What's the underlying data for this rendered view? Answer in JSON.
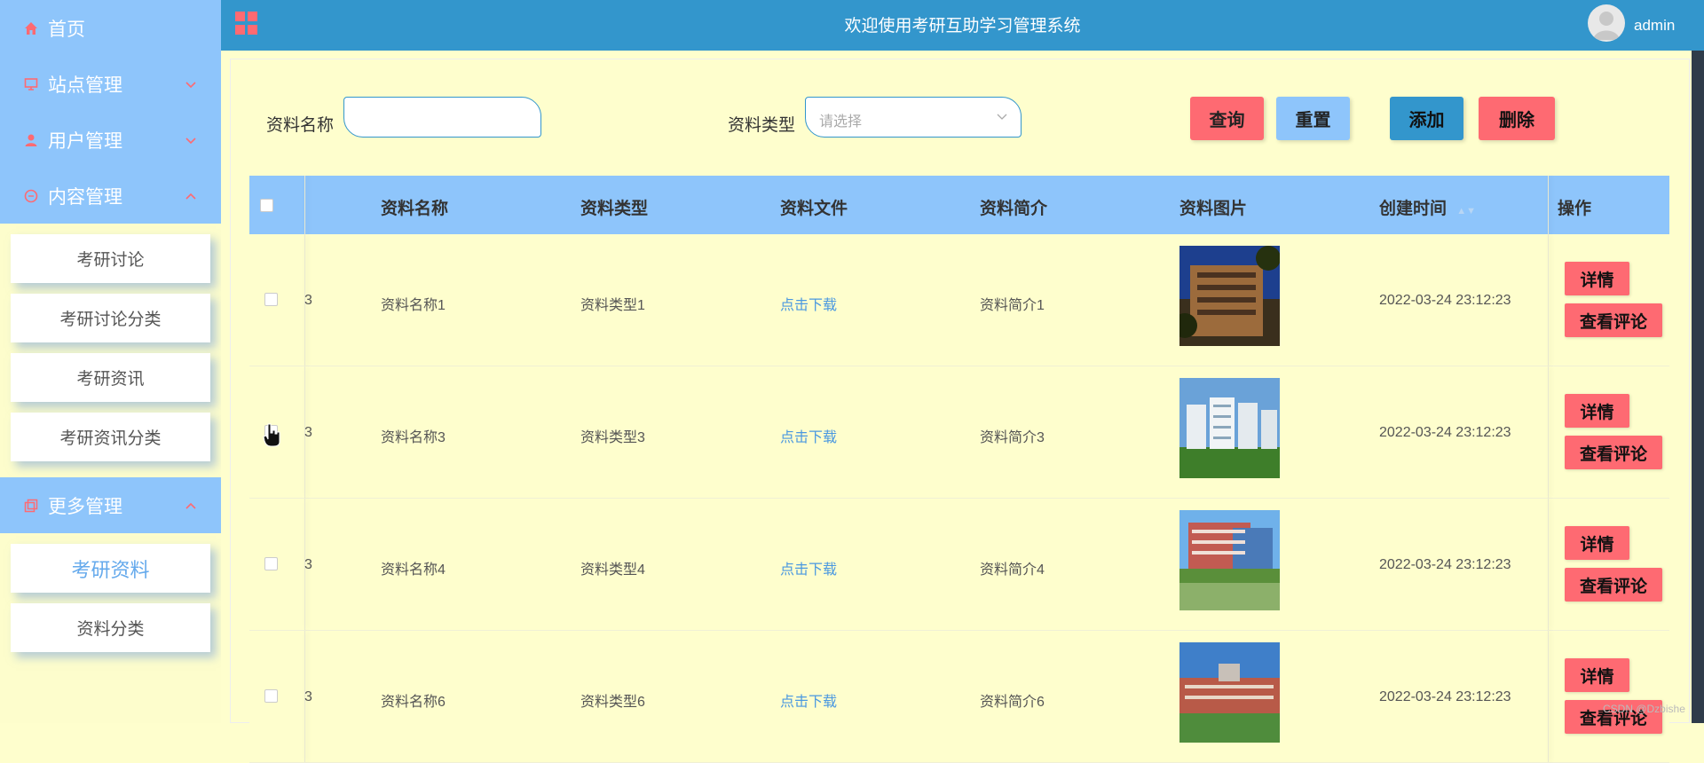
{
  "app": {
    "title": "欢迎使用考研互助学习管理系统",
    "username": "admin"
  },
  "colors": {
    "primary": "#3396cc",
    "sidebar": "#8ec5fb",
    "accent": "#fe6a72",
    "page_bg": "#fefecd"
  },
  "sidebar": {
    "home": "首页",
    "site": "站点管理",
    "users": "用户管理",
    "content": "内容管理",
    "content_items": [
      "考研讨论",
      "考研讨论分类",
      "考研资讯",
      "考研资讯分类"
    ],
    "more": "更多管理",
    "more_items": [
      "考研资料",
      "资料分类"
    ],
    "active_item": "考研资料"
  },
  "search": {
    "name_label": "资料名称",
    "name_value": "",
    "type_label": "资料类型",
    "type_placeholder": "请选择",
    "query": "查询",
    "reset": "重置",
    "add": "添加",
    "delete": "删除"
  },
  "table": {
    "headers": {
      "name": "资料名称",
      "type": "资料类型",
      "file": "资料文件",
      "intro": "资料简介",
      "image": "资料图片",
      "created": "创建时间",
      "ops": "操作"
    },
    "rows": [
      {
        "idx": "3",
        "name": "资料名称1",
        "type": "资料类型1",
        "file": "点击下载",
        "intro": "资料简介1",
        "created": "2022-03-24 23:12:23",
        "image": "campus-building-night"
      },
      {
        "idx": "3",
        "name": "资料名称3",
        "type": "资料类型3",
        "file": "点击下载",
        "intro": "资料简介3",
        "created": "2022-03-24 23:12:23",
        "image": "campus-white-buildings"
      },
      {
        "idx": "3",
        "name": "资料名称4",
        "type": "资料类型4",
        "file": "点击下载",
        "intro": "资料简介4",
        "created": "2022-03-24 23:12:23",
        "image": "campus-lake"
      },
      {
        "idx": "3",
        "name": "资料名称6",
        "type": "资料类型6",
        "file": "点击下载",
        "intro": "资料简介6",
        "created": "2022-03-24 23:12:23",
        "image": "campus-brick-building"
      }
    ],
    "detail": "详情",
    "comments": "查看评论"
  },
  "watermark": "CSDN @Dzbishe"
}
